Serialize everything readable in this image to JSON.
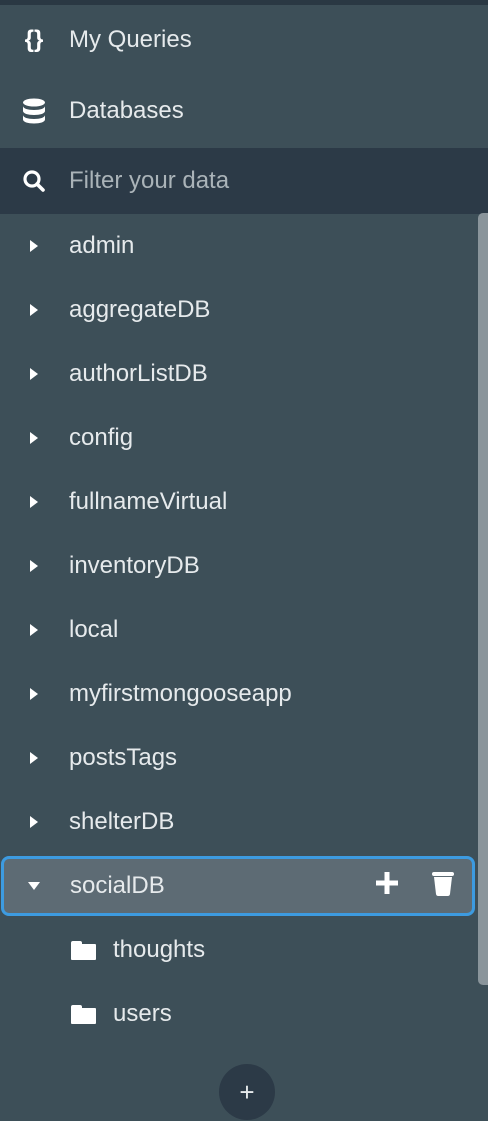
{
  "nav": {
    "my_queries": "My Queries",
    "databases": "Databases"
  },
  "filter": {
    "placeholder": "Filter your data",
    "value": ""
  },
  "databases": [
    {
      "name": "admin",
      "expanded": false
    },
    {
      "name": "aggregateDB",
      "expanded": false
    },
    {
      "name": "authorListDB",
      "expanded": false
    },
    {
      "name": "config",
      "expanded": false
    },
    {
      "name": "fullnameVirtual",
      "expanded": false
    },
    {
      "name": "inventoryDB",
      "expanded": false
    },
    {
      "name": "local",
      "expanded": false
    },
    {
      "name": "myfirstmongooseapp",
      "expanded": false
    },
    {
      "name": "postsTags",
      "expanded": false
    },
    {
      "name": "shelterDB",
      "expanded": false
    },
    {
      "name": "socialDB",
      "expanded": true,
      "selected": true,
      "collections": [
        "thoughts",
        "users"
      ]
    }
  ],
  "add_button": "+",
  "colors": {
    "background": "#3d4f58",
    "filter_bg": "#2c3a47",
    "selected_bg": "#5d6b74",
    "selected_border": "#3d9be0"
  }
}
